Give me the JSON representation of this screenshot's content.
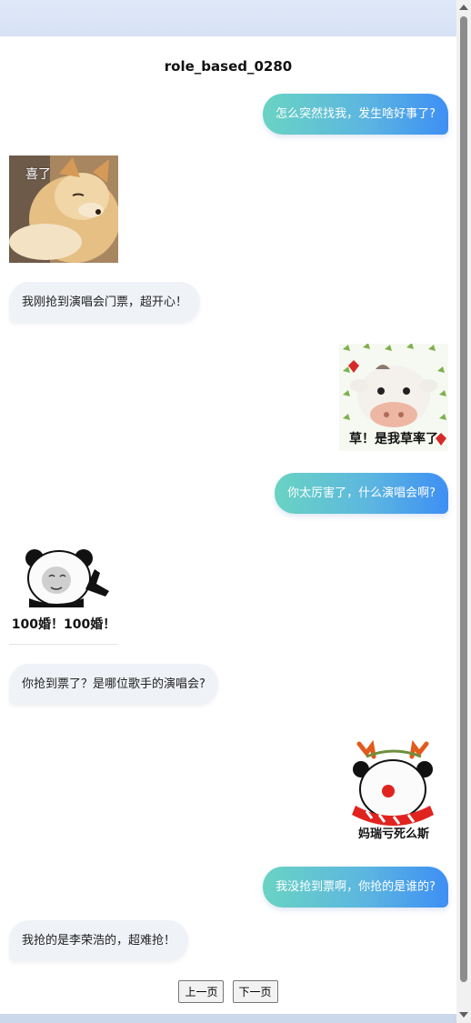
{
  "page": {
    "title": "role_based_0280"
  },
  "messages": [
    {
      "side": "right",
      "type": "text",
      "text": "怎么突然找我，发生啥好事了?"
    },
    {
      "side": "left",
      "type": "sticker",
      "caption": "喜了",
      "icon": "shiba-dog-sticker"
    },
    {
      "side": "left",
      "type": "text",
      "text": "我刚抢到演唱会门票，超开心！"
    },
    {
      "side": "right",
      "type": "sticker",
      "caption": "草！是我草率了",
      "icon": "crying-cow-sticker"
    },
    {
      "side": "right",
      "type": "text",
      "text": "你太厉害了，什么演唱会啊?"
    },
    {
      "side": "left",
      "type": "sticker",
      "caption": "100婚！100婚！",
      "icon": "panda-meme-sticker"
    },
    {
      "side": "left",
      "type": "text",
      "text": "你抢到票了？是哪位歌手的演唱会?"
    },
    {
      "side": "right",
      "type": "sticker",
      "caption": "妈瑞亏死么斯",
      "icon": "panda-reindeer-sticker"
    },
    {
      "side": "right",
      "type": "text",
      "text": "我没抢到票啊，你抢的是谁的?"
    },
    {
      "side": "left",
      "type": "text",
      "text": "我抢的是李荣浩的，超难抢！"
    }
  ],
  "pagination": {
    "prev_label": "上一页",
    "next_label": "下一页"
  },
  "colors": {
    "bubble_gradient_start": "#6ad3c3",
    "bubble_gradient_end": "#3e8ff4",
    "left_bubble": "#eff2f7"
  }
}
